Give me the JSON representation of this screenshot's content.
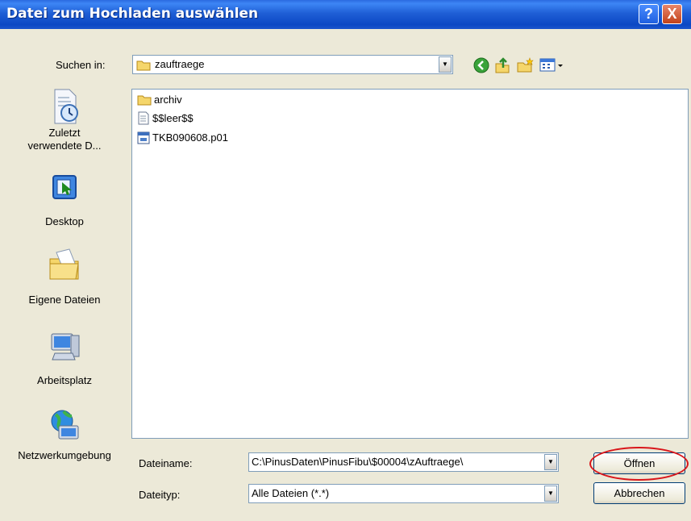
{
  "window": {
    "title": "Datei zum Hochladen auswählen",
    "help_glyph": "?",
    "close_glyph": "X"
  },
  "lookin": {
    "label": "Suchen in:",
    "value": "zauftraege",
    "toolbar_icons": [
      "back-icon",
      "up-folder-icon",
      "new-folder-icon",
      "view-menu-icon"
    ]
  },
  "places": [
    {
      "label": "Zuletzt verwendete D...",
      "icon": "recent-documents-icon"
    },
    {
      "label": "Desktop",
      "icon": "desktop-icon"
    },
    {
      "label": "Eigene Dateien",
      "icon": "my-documents-icon"
    },
    {
      "label": "Arbeitsplatz",
      "icon": "my-computer-icon"
    },
    {
      "label": "Netzwerkumgebung",
      "icon": "network-icon"
    }
  ],
  "files": [
    {
      "name": "archiv",
      "icon": "folder-icon"
    },
    {
      "name": "$$leer$$",
      "icon": "text-file-icon"
    },
    {
      "name": "TKB090608.p01",
      "icon": "data-file-icon"
    }
  ],
  "filename": {
    "label": "Dateiname:",
    "value": "C:\\PinusDaten\\PinusFibu\\$00004\\zAuftraege\\"
  },
  "filetype": {
    "label": "Dateityp:",
    "value": "Alle Dateien (*.*)"
  },
  "buttons": {
    "open": "Öffnen",
    "cancel": "Abbrechen"
  },
  "colors": {
    "titlebar": "#0c48c4",
    "dialog_bg": "#ece9d8",
    "highlight_ring": "#d9161b"
  }
}
